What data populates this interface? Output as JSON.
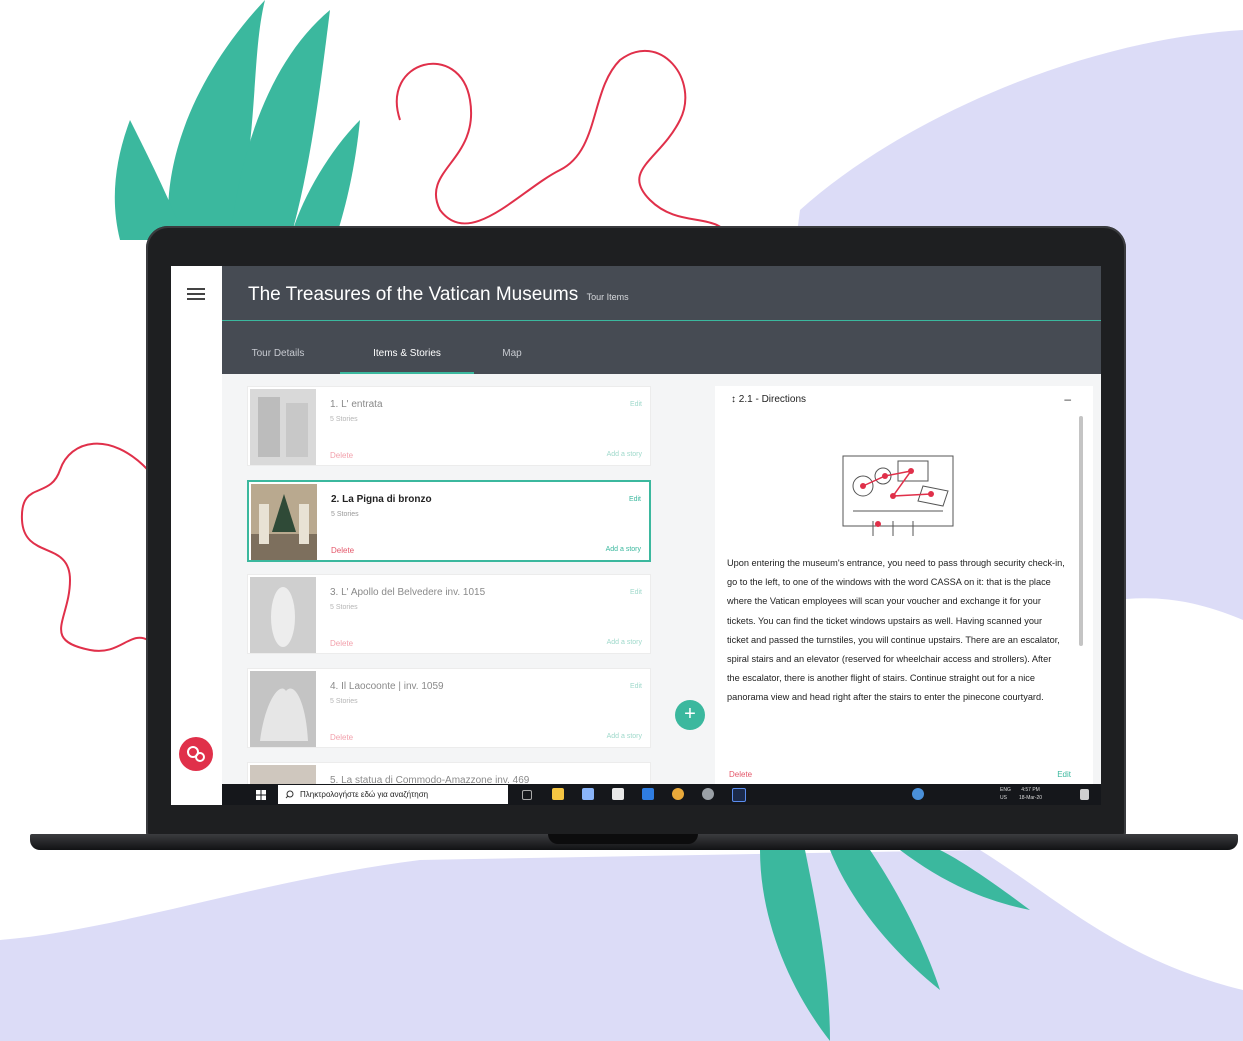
{
  "app": {
    "title": "The Treasures of the Vatican Museums",
    "subtitle": "Tour Items"
  },
  "tabs": [
    {
      "label": "Tour Details",
      "active": false
    },
    {
      "label": "Items & Stories",
      "active": true
    },
    {
      "label": "Map",
      "active": false
    }
  ],
  "items": [
    {
      "title": "1. L' entrata",
      "stories": "5 Stories",
      "delete": "Delete",
      "edit": "Edit",
      "add": "Add a story",
      "selected": false
    },
    {
      "title": "2. La Pigna di bronzo",
      "stories": "5 Stories",
      "delete": "Delete",
      "edit": "Edit",
      "add": "Add a story",
      "selected": true
    },
    {
      "title": "3. L' Apollo del Belvedere inv. 1015",
      "stories": "5 Stories",
      "delete": "Delete",
      "edit": "Edit",
      "add": "Add a story",
      "selected": false
    },
    {
      "title": "4. Il Laocoonte | inv. 1059",
      "stories": "5 Stories",
      "delete": "Delete",
      "edit": "Edit",
      "add": "Add a story",
      "selected": false
    },
    {
      "title": "5. La statua di Commodo-Amazzone inv. 469",
      "stories": "",
      "delete": "",
      "edit": "",
      "add": "",
      "selected": false
    }
  ],
  "fab": {
    "label": "+"
  },
  "story": {
    "heading": "2.1 - Directions",
    "collapse": "–",
    "text": "Upon entering the museum's entrance, you need to pass through security check-in, go to the left, to one of the windows with the word CASSA on it: that is the place where the Vatican employees will scan your voucher and exchange it for your tickets. You can find the ticket windows upstairs as well. Having scanned your ticket and passed the turnstiles, you will continue upstairs. There are an escalator, spiral stairs and an elevator (reserved for wheelchair access and strollers). After the escalator, there is another flight of stairs. Continue straight out for a nice panorama view and head right after the stairs to enter the pinecone courtyard.",
    "delete": "Delete",
    "edit": "Edit"
  },
  "taskbar": {
    "search_placeholder": "Πληκτρολογήστε εδώ για αναζήτηση",
    "lang_line1": "ENG",
    "lang_line2": "US",
    "time": "4:57 PM",
    "date": "18-Mar-20"
  },
  "colors": {
    "accent": "#3bb89e",
    "header": "#464b53",
    "danger": "#e4576a",
    "blob": "#dcdcf7"
  },
  "icons": {
    "menu": "hamburger-icon",
    "drag": "drag-vertical-icon",
    "windows": "windows-start-icon",
    "search": "search-icon"
  }
}
